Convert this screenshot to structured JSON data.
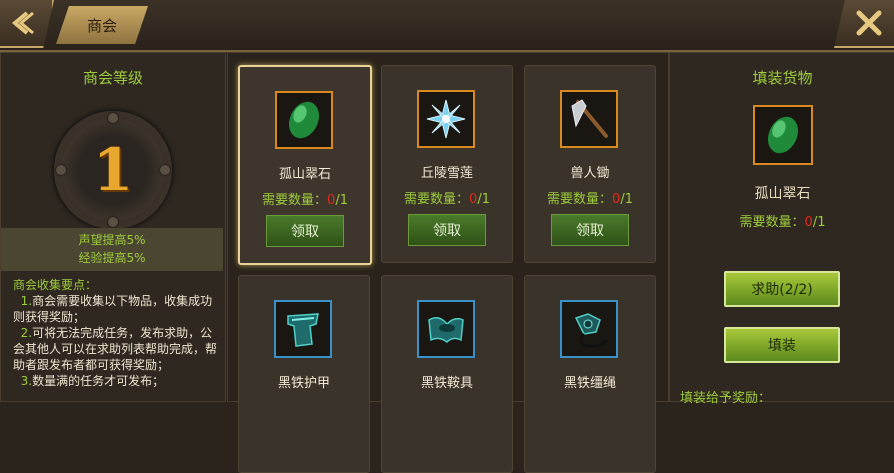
{
  "header": {
    "title": "商会"
  },
  "left": {
    "title": "商会等级",
    "level": "1",
    "bonus": [
      "声望提高5%",
      "经验提高5%"
    ],
    "notes_title": "商会收集要点：",
    "notes": [
      {
        "num": "1.",
        "text": "商会需要收集以下物品，收集成功则获得奖励；"
      },
      {
        "num": "2.",
        "text": "可将无法完成任务，发布求助，公会其他人可以在求助列表帮助完成，帮助者跟发布者都可获得奖励；"
      },
      {
        "num": "3.",
        "text": "数量满的任务才可发布；"
      }
    ]
  },
  "items": [
    {
      "name": "孤山翠石",
      "req_label": "需要数量：",
      "have": "0",
      "need": "/1",
      "button": "领取"
    },
    {
      "name": "丘陵雪莲",
      "req_label": "需要数量：",
      "have": "0",
      "need": "/1",
      "button": "领取"
    },
    {
      "name": "兽人锄",
      "req_label": "需要数量：",
      "have": "0",
      "need": "/1",
      "button": "领取"
    },
    {
      "name": "黑铁护甲"
    },
    {
      "name": "黑铁鞍具"
    },
    {
      "name": "黑铁缰绳"
    }
  ],
  "right": {
    "title": "填装货物",
    "item_name": "孤山翠石",
    "req_label": "需要数量：",
    "have": "0",
    "need": "/1",
    "help_button": "求助(2/2)",
    "fill_button": "填装",
    "reward_title": "填装给予奖励："
  },
  "colors": {
    "accent_green": "#9ecc3c",
    "count_red": "#e02a1a",
    "gold": "#c8a868"
  }
}
